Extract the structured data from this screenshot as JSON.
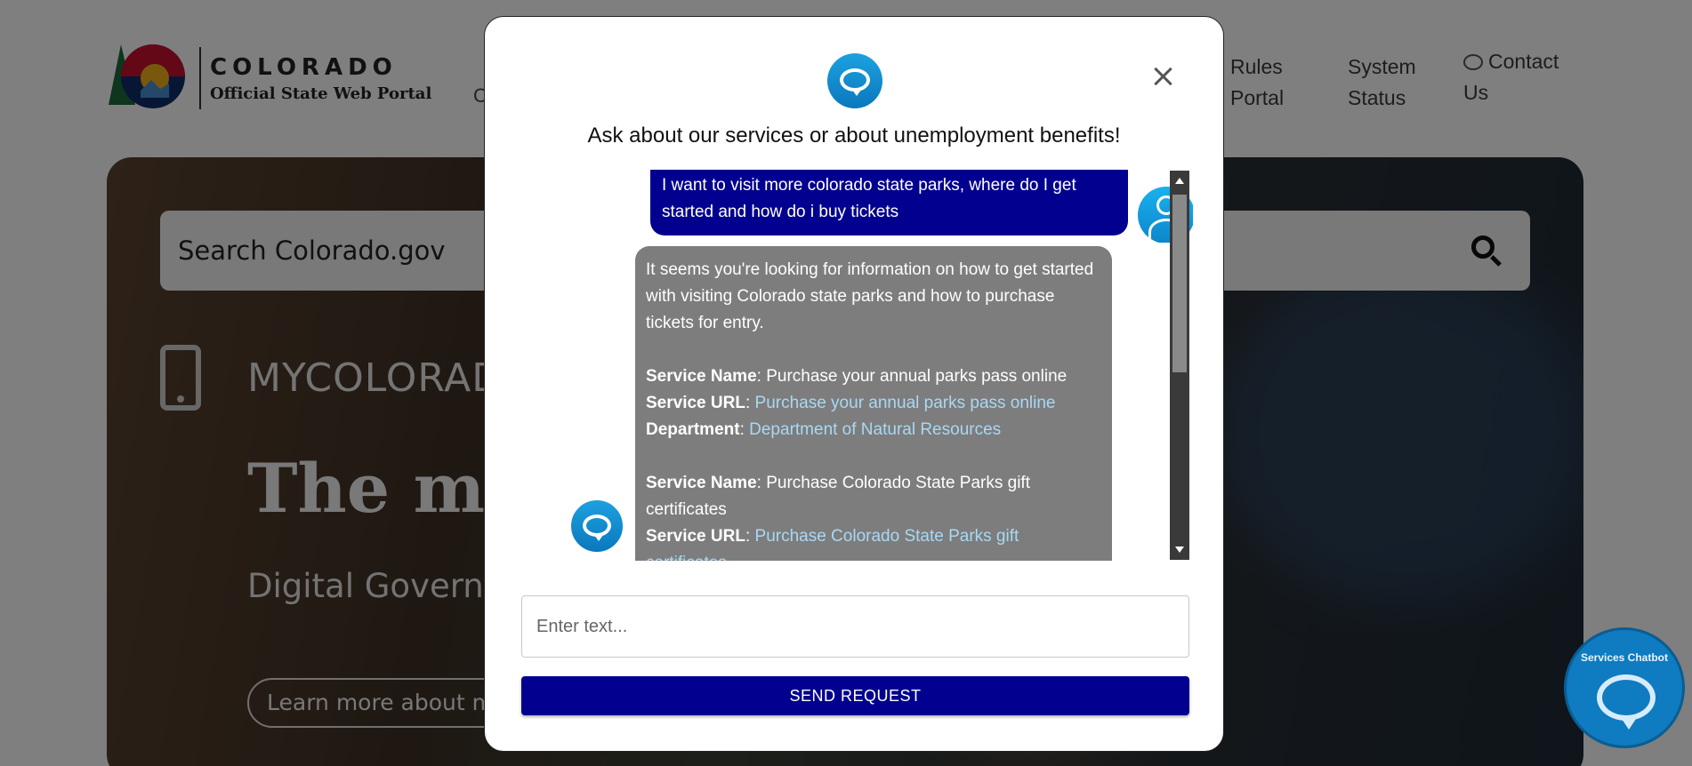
{
  "background": {
    "logo": {
      "brand": "COLORADO",
      "subtitle": "Official State Web Portal"
    },
    "nav": {
      "fragment": "C",
      "rules_line1": "Rules",
      "rules_line2": "Portal",
      "status_line1": "System",
      "status_line2": "Status",
      "contact_line1": "Contact",
      "contact_line2": "Us"
    },
    "search": {
      "placeholder": "Search Colorado.gov"
    },
    "hero": {
      "kicker": "MYCOLORAD",
      "title": "The my",
      "subtitle": "Digital Governm",
      "button": "Learn more about my"
    },
    "launcher": {
      "label": "Services Chatbot"
    }
  },
  "modal": {
    "heading": "Ask about our services or about unemployment benefits!",
    "user_message": "I want to visit more colorado state parks, where do I get started and how do i buy tickets",
    "bot_message": {
      "intro": "It seems you're looking for information on how to get started with visiting Colorado state parks and how to purchase tickets for entry.",
      "services": [
        {
          "name_label": "Service Name",
          "name": ": Purchase your annual parks pass online",
          "url_label": "Service URL",
          "url": "Purchase your annual parks pass online",
          "dept_label": "Department",
          "dept": "Department of Natural Resources"
        },
        {
          "name_label": "Service Name",
          "name": ": Purchase Colorado State Parks gift certificates",
          "url_label": "Service URL",
          "url": "Purchase Colorado State Parks gift certificates"
        }
      ]
    },
    "input": {
      "placeholder": "Enter text...",
      "value": ""
    },
    "send_label": "SEND REQUEST"
  },
  "colors": {
    "primary_navy": "#02008e",
    "bot_bubble": "#7d7d7d",
    "link": "#a8d8f5",
    "accent_blue": "#0f7bc0"
  },
  "icons": [
    "colorado-logo-icon",
    "chat-icon",
    "search-icon",
    "phone-icon",
    "chatbot-icon",
    "close-icon",
    "user-avatar-icon",
    "scroll-up-icon",
    "scroll-down-icon"
  ]
}
